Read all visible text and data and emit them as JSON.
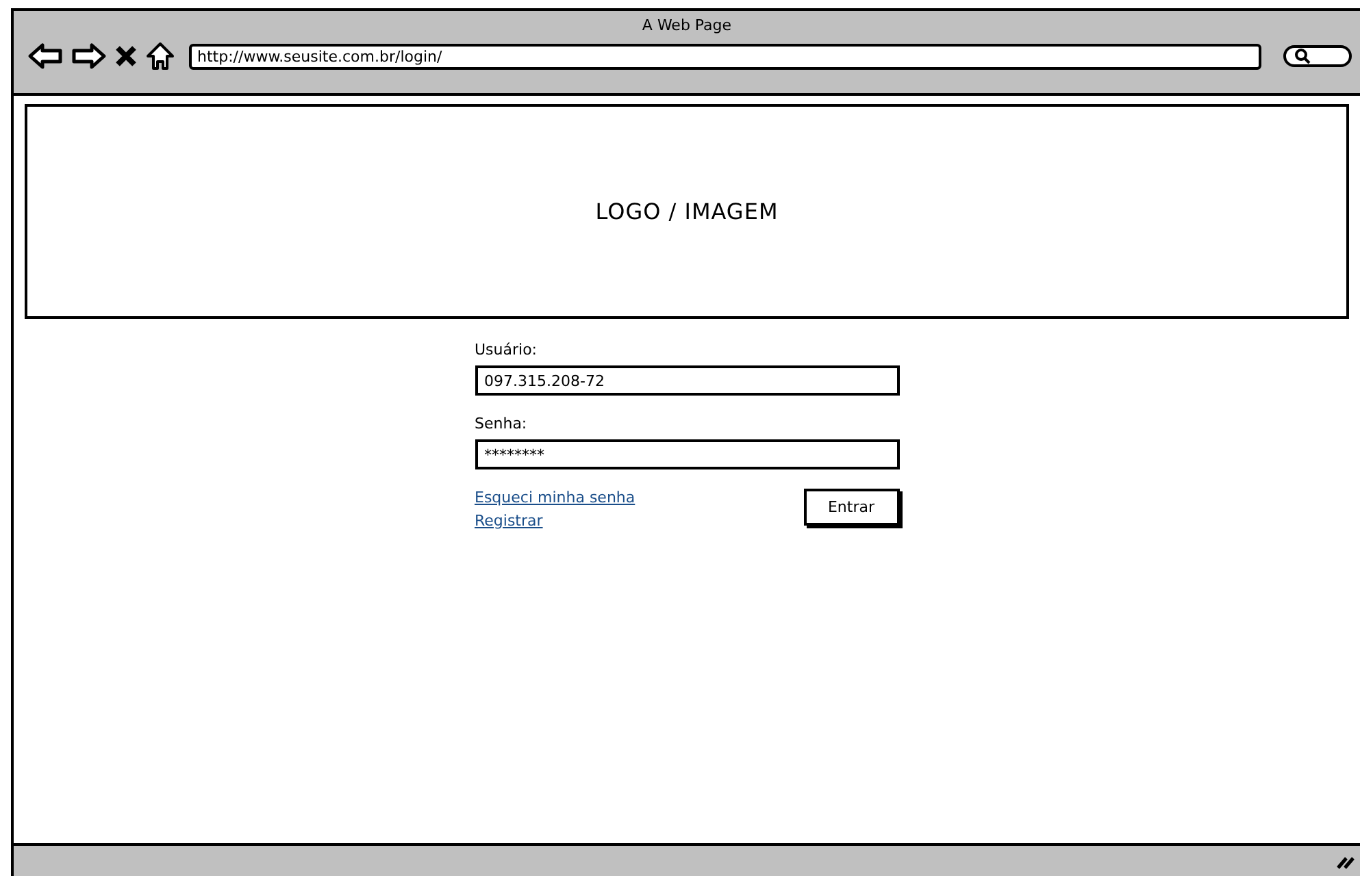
{
  "window": {
    "title": "A Web Page",
    "url": "http://www.seusite.com.br/login/"
  },
  "banner": {
    "label": "LOGO / IMAGEM"
  },
  "form": {
    "fields": [
      {
        "label": "Usuário:",
        "value": "097.315.208-72"
      },
      {
        "label": "Senha:",
        "value": "********"
      }
    ],
    "links": [
      "Esqueci minha senha",
      "Registrar"
    ],
    "submit": "Entrar"
  }
}
